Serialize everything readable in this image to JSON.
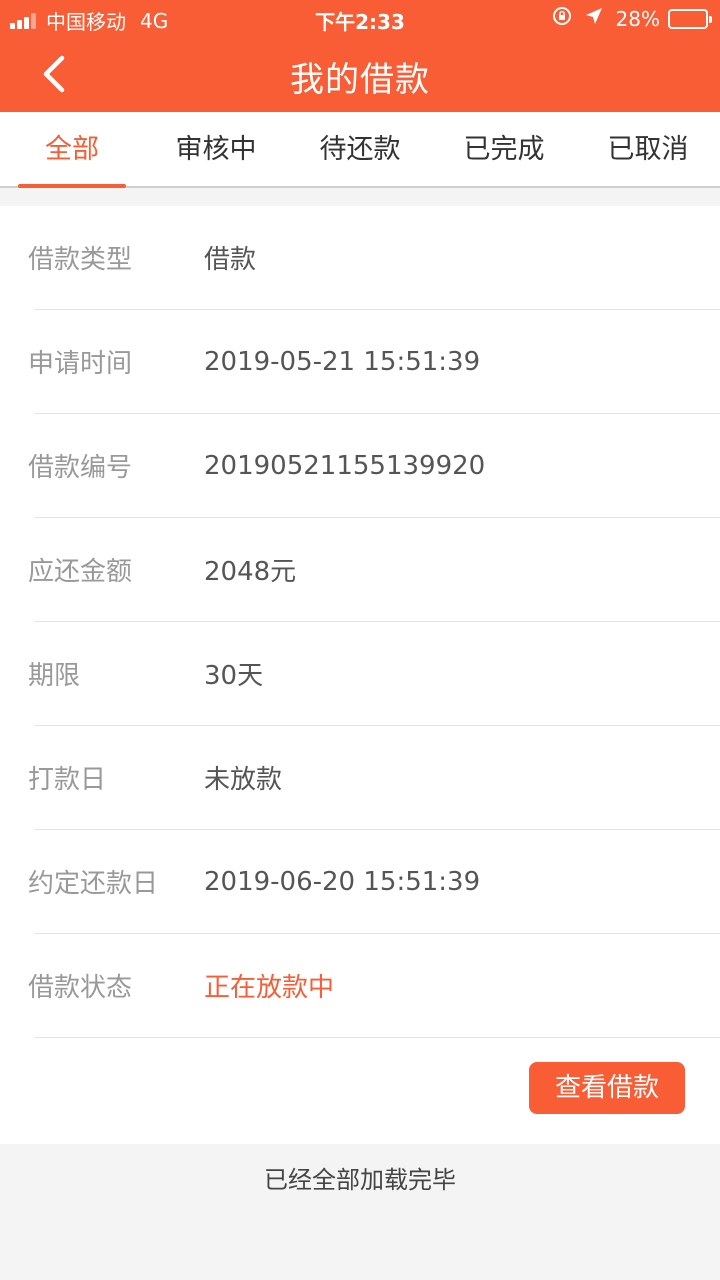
{
  "status_bar": {
    "carrier": "中国移动",
    "network": "4G",
    "time": "下午2:33",
    "battery_text": "28%",
    "battery_percent": 28
  },
  "header": {
    "title": "我的借款"
  },
  "tabs": [
    {
      "label": "全部",
      "active": true
    },
    {
      "label": "审核中",
      "active": false
    },
    {
      "label": "待还款",
      "active": false
    },
    {
      "label": "已完成",
      "active": false
    },
    {
      "label": "已取消",
      "active": false
    }
  ],
  "loan": {
    "rows": [
      {
        "label": "借款类型",
        "value": "借款"
      },
      {
        "label": "申请时间",
        "value": "2019-05-21 15:51:39"
      },
      {
        "label": "借款编号",
        "value": "20190521155139920"
      },
      {
        "label": "应还金额",
        "value": "2048元"
      },
      {
        "label": "期限",
        "value": "30天"
      },
      {
        "label": "打款日",
        "value": "未放款"
      },
      {
        "label": "约定还款日",
        "value": "2019-06-20 15:51:39"
      },
      {
        "label": "借款状态",
        "value": "正在放款中"
      }
    ],
    "view_button": "查看借款"
  },
  "footer": {
    "text": "已经全部加载完毕"
  },
  "colors": {
    "accent": "#f85d35"
  },
  "icons": {
    "back": "chevron-left-icon",
    "lock": "rotation-lock-icon",
    "location": "location-arrow-icon"
  }
}
